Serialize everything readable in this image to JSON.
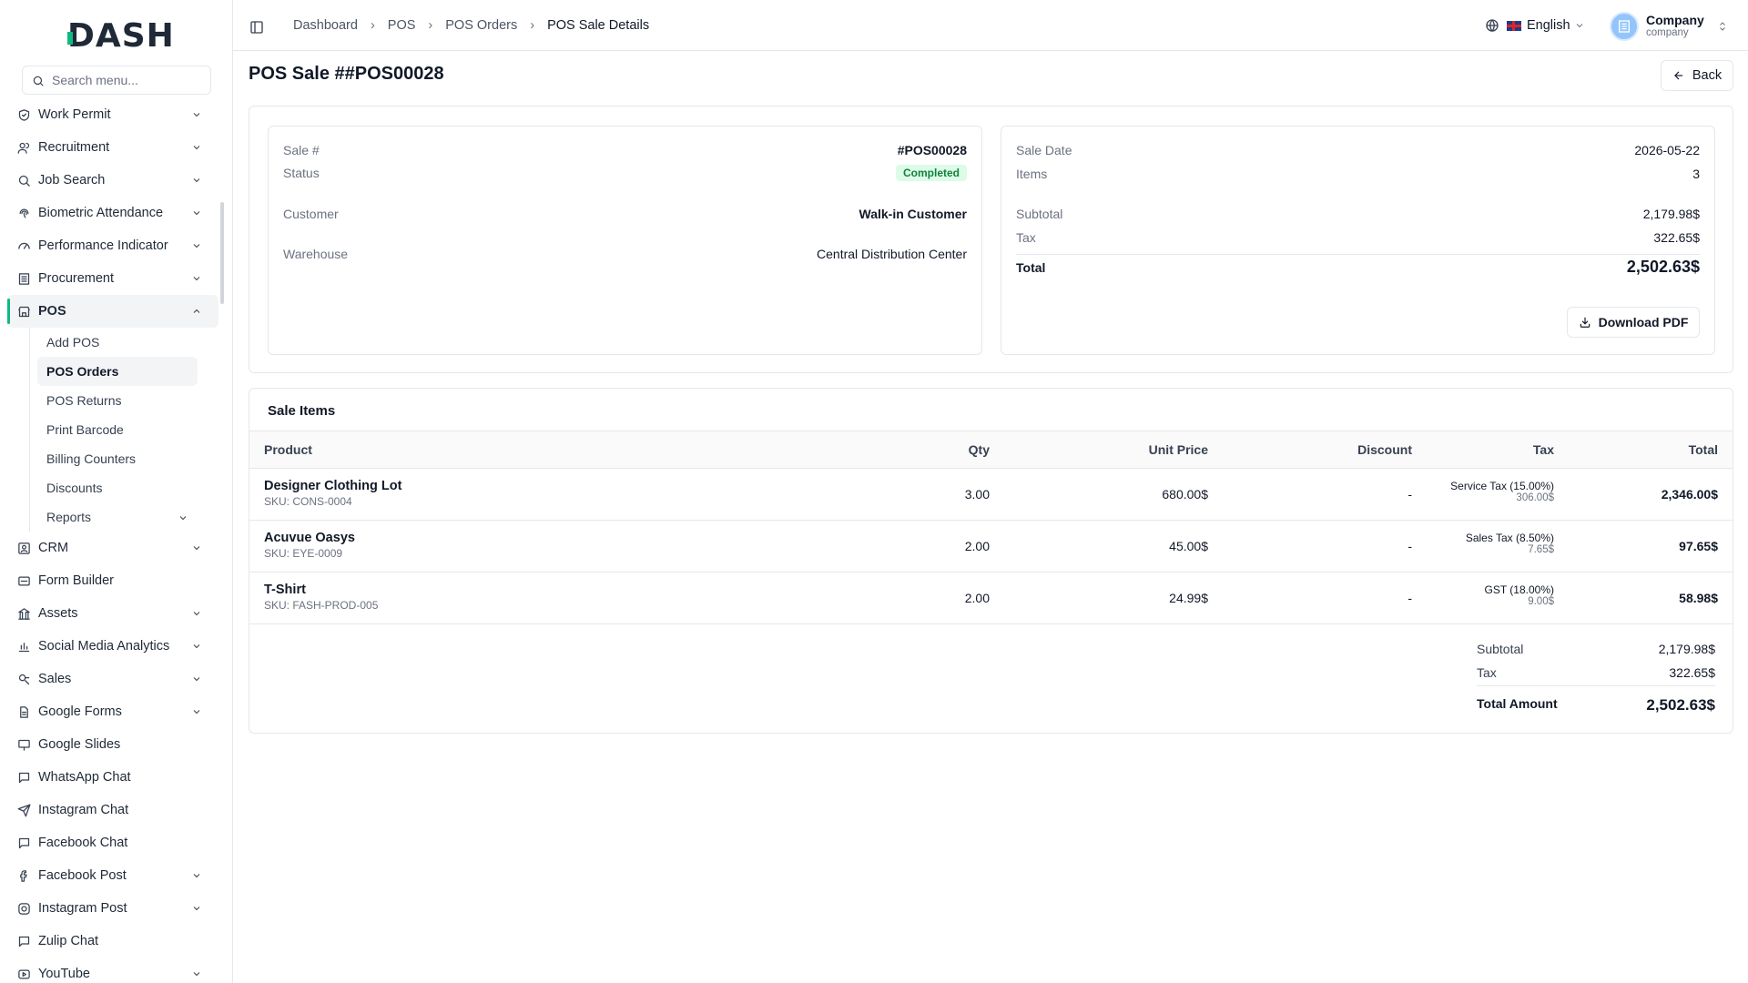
{
  "brand": {
    "logo_text": "DASH"
  },
  "sidebar": {
    "search_placeholder": "Search menu...",
    "items": [
      {
        "label": "Work Permit",
        "icon": "shield-check-icon",
        "has_chevron": true
      },
      {
        "label": "Recruitment",
        "icon": "users-icon",
        "has_chevron": true
      },
      {
        "label": "Job Search",
        "icon": "search-icon",
        "has_chevron": true
      },
      {
        "label": "Biometric Attendance",
        "icon": "fingerprint-icon",
        "has_chevron": true
      },
      {
        "label": "Performance Indicator",
        "icon": "gauge-icon",
        "has_chevron": true
      },
      {
        "label": "Procurement",
        "icon": "building-icon",
        "has_chevron": true
      },
      {
        "label": "POS",
        "icon": "store-icon",
        "has_chevron": true,
        "active": true
      }
    ],
    "pos_sub": [
      {
        "label": "Add POS"
      },
      {
        "label": "POS Orders",
        "active": true
      },
      {
        "label": "POS Returns"
      },
      {
        "label": "Print Barcode"
      },
      {
        "label": "Billing Counters"
      },
      {
        "label": "Discounts"
      },
      {
        "label": "Reports",
        "has_chevron": true
      }
    ],
    "items_after": [
      {
        "label": "CRM",
        "icon": "contact-icon",
        "has_chevron": true
      },
      {
        "label": "Form Builder",
        "icon": "form-icon",
        "has_chevron": false
      },
      {
        "label": "Assets",
        "icon": "assets-icon",
        "has_chevron": true
      },
      {
        "label": "Social Media Analytics",
        "icon": "bar-chart-icon",
        "has_chevron": true
      },
      {
        "label": "Sales",
        "icon": "sales-icon",
        "has_chevron": true
      },
      {
        "label": "Google Forms",
        "icon": "file-text-icon",
        "has_chevron": true
      },
      {
        "label": "Google Slides",
        "icon": "presentation-icon",
        "has_chevron": false
      },
      {
        "label": "WhatsApp Chat",
        "icon": "message-icon",
        "has_chevron": false
      },
      {
        "label": "Instagram Chat",
        "icon": "send-icon",
        "has_chevron": false
      },
      {
        "label": "Facebook Chat",
        "icon": "message-icon",
        "has_chevron": false
      },
      {
        "label": "Facebook Post",
        "icon": "facebook-icon",
        "has_chevron": true
      },
      {
        "label": "Instagram Post",
        "icon": "instagram-icon",
        "has_chevron": true
      },
      {
        "label": "Zulip Chat",
        "icon": "message-icon",
        "has_chevron": false
      },
      {
        "label": "YouTube",
        "icon": "youtube-icon",
        "has_chevron": true
      }
    ]
  },
  "header": {
    "breadcrumb": [
      "Dashboard",
      "POS",
      "POS Orders",
      "POS Sale Details"
    ],
    "language": "English",
    "company_name": "Company",
    "company_role": "company"
  },
  "page": {
    "title": "POS Sale ##POS00028",
    "back_label": "Back"
  },
  "sale_info": {
    "sale_no_label": "Sale #",
    "sale_no": "#POS00028",
    "status_label": "Status",
    "status": "Completed",
    "customer_label": "Customer",
    "customer": "Walk-in Customer",
    "warehouse_label": "Warehouse",
    "warehouse": "Central Distribution Center"
  },
  "sale_summary": {
    "date_label": "Sale Date",
    "date": "2026-05-22",
    "items_label": "Items",
    "items": "3",
    "subtotal_label": "Subtotal",
    "subtotal": "2,179.98$",
    "tax_label": "Tax",
    "tax": "322.65$",
    "total_label": "Total",
    "total": "2,502.63$",
    "download_label": "Download PDF"
  },
  "sale_items": {
    "title": "Sale Items",
    "columns": [
      "Product",
      "Qty",
      "Unit Price",
      "Discount",
      "Tax",
      "Total"
    ],
    "rows": [
      {
        "product": "Designer Clothing Lot",
        "sku": "SKU: CONS-0004",
        "qty": "3.00",
        "unit_price": "680.00$",
        "discount": "-",
        "tax_name": "Service Tax (15.00%)",
        "tax_amount": "306.00$",
        "total": "2,346.00$"
      },
      {
        "product": "Acuvue Oasys",
        "sku": "SKU: EYE-0009",
        "qty": "2.00",
        "unit_price": "45.00$",
        "discount": "-",
        "tax_name": "Sales Tax (8.50%)",
        "tax_amount": "7.65$",
        "total": "97.65$"
      },
      {
        "product": "T-Shirt",
        "sku": "SKU: FASH-PROD-005",
        "qty": "2.00",
        "unit_price": "24.99$",
        "discount": "-",
        "tax_name": "GST (18.00%)",
        "tax_amount": "9.00$",
        "total": "58.98$"
      }
    ],
    "subtotal_label": "Subtotal",
    "subtotal": "2,179.98$",
    "tax_label": "Tax",
    "tax": "322.65$",
    "total_label": "Total Amount",
    "total": "2,502.63$"
  },
  "colors": {
    "accent": "#10b981",
    "badge_bg": "#dcfce7",
    "badge_text": "#15803d",
    "border": "#e5e7eb"
  }
}
